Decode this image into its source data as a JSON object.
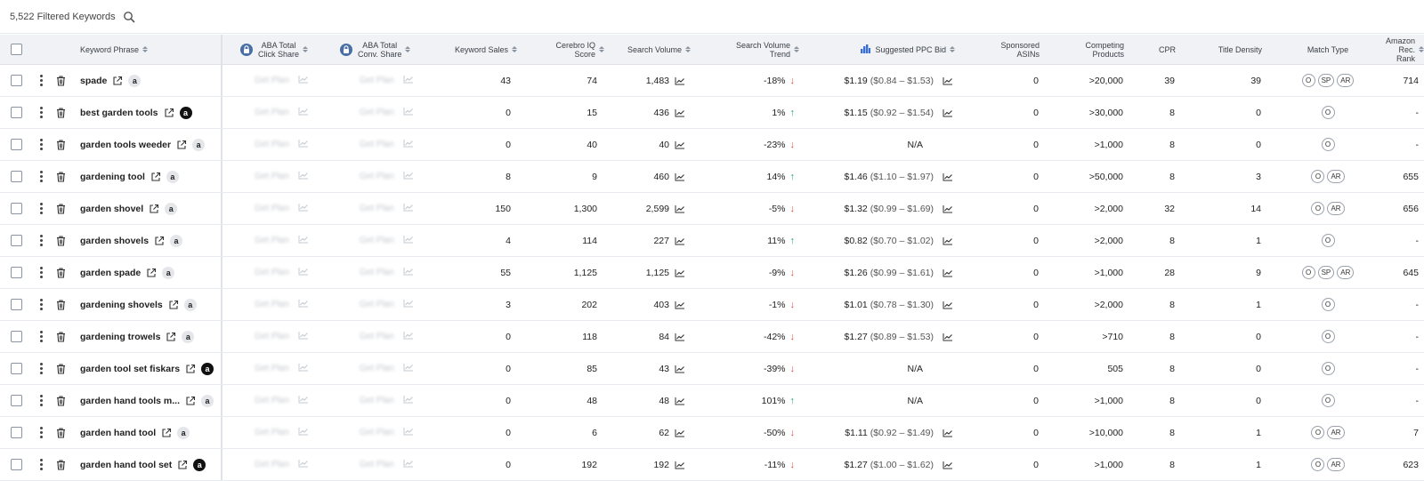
{
  "toolbar": {
    "filtered_count": "5,522 Filtered Keywords"
  },
  "columns": {
    "keyword_phrase": "Keyword Phrase",
    "aba_click_1": "ABA Total",
    "aba_click_2": "Click Share",
    "aba_conv_1": "ABA Total",
    "aba_conv_2": "Conv. Share",
    "keyword_sales": "Keyword Sales",
    "cerebro_1": "Cerebro IQ",
    "cerebro_2": "Score",
    "search_volume": "Search Volume",
    "sv_trend_1": "Search Volume",
    "sv_trend_2": "Trend",
    "ppc": "Suggested PPC Bid",
    "sponsored_1": "Sponsored",
    "sponsored_2": "ASINs",
    "competing_1": "Competing",
    "competing_2": "Products",
    "cpr": "CPR",
    "title_density": "Title Density",
    "match_type": "Match Type",
    "amazon_rank_1": "Amazon Rec.",
    "amazon_rank_2": "Rank"
  },
  "blurred_text": "Get Plan",
  "rows": [
    {
      "keyword": "spade",
      "amz": "light",
      "sales": "43",
      "iq": "74",
      "volume": "1,483",
      "trend": "-18%",
      "dir": "down",
      "ppc": "$1.19",
      "ppc_range": "($0.84 – $1.53)",
      "sponsored": "0",
      "competing": ">20,000",
      "cpr": "39",
      "title_density": "39",
      "match": [
        "O",
        "SP",
        "AR"
      ],
      "rank": "714"
    },
    {
      "keyword": "best garden tools",
      "amz": "dark",
      "sales": "0",
      "iq": "15",
      "volume": "436",
      "trend": "1%",
      "dir": "up",
      "ppc": "$1.15",
      "ppc_range": "($0.92 – $1.54)",
      "sponsored": "0",
      "competing": ">30,000",
      "cpr": "8",
      "title_density": "0",
      "match": [
        "O"
      ],
      "rank": "-"
    },
    {
      "keyword": "garden tools weeder",
      "amz": "light",
      "sales": "0",
      "iq": "40",
      "volume": "40",
      "trend": "-23%",
      "dir": "down",
      "ppc": "N/A",
      "ppc_range": "",
      "sponsored": "0",
      "competing": ">1,000",
      "cpr": "8",
      "title_density": "0",
      "match": [
        "O"
      ],
      "rank": "-"
    },
    {
      "keyword": "gardening tool",
      "amz": "light",
      "sales": "8",
      "iq": "9",
      "volume": "460",
      "trend": "14%",
      "dir": "up",
      "ppc": "$1.46",
      "ppc_range": "($1.10 – $1.97)",
      "sponsored": "0",
      "competing": ">50,000",
      "cpr": "8",
      "title_density": "3",
      "match": [
        "O",
        "AR"
      ],
      "rank": "655"
    },
    {
      "keyword": "garden shovel",
      "amz": "light",
      "sales": "150",
      "iq": "1,300",
      "volume": "2,599",
      "trend": "-5%",
      "dir": "down",
      "ppc": "$1.32",
      "ppc_range": "($0.99 – $1.69)",
      "sponsored": "0",
      "competing": ">2,000",
      "cpr": "32",
      "title_density": "14",
      "match": [
        "O",
        "AR"
      ],
      "rank": "656"
    },
    {
      "keyword": "garden shovels",
      "amz": "light",
      "sales": "4",
      "iq": "114",
      "volume": "227",
      "trend": "11%",
      "dir": "up",
      "ppc": "$0.82",
      "ppc_range": "($0.70 – $1.02)",
      "sponsored": "0",
      "competing": ">2,000",
      "cpr": "8",
      "title_density": "1",
      "match": [
        "O"
      ],
      "rank": "-"
    },
    {
      "keyword": "garden spade",
      "amz": "light",
      "sales": "55",
      "iq": "1,125",
      "volume": "1,125",
      "trend": "-9%",
      "dir": "down",
      "ppc": "$1.26",
      "ppc_range": "($0.99 – $1.61)",
      "sponsored": "0",
      "competing": ">1,000",
      "cpr": "28",
      "title_density": "9",
      "match": [
        "O",
        "SP",
        "AR"
      ],
      "rank": "645"
    },
    {
      "keyword": "gardening shovels",
      "amz": "light",
      "sales": "3",
      "iq": "202",
      "volume": "403",
      "trend": "-1%",
      "dir": "down",
      "ppc": "$1.01",
      "ppc_range": "($0.78 – $1.30)",
      "sponsored": "0",
      "competing": ">2,000",
      "cpr": "8",
      "title_density": "1",
      "match": [
        "O"
      ],
      "rank": "-"
    },
    {
      "keyword": "gardening trowels",
      "amz": "light",
      "sales": "0",
      "iq": "118",
      "volume": "84",
      "trend": "-42%",
      "dir": "down",
      "ppc": "$1.27",
      "ppc_range": "($0.89 – $1.53)",
      "sponsored": "0",
      "competing": ">710",
      "cpr": "8",
      "title_density": "0",
      "match": [
        "O"
      ],
      "rank": "-"
    },
    {
      "keyword": "garden tool set fiskars",
      "amz": "dark",
      "sales": "0",
      "iq": "85",
      "volume": "43",
      "trend": "-39%",
      "dir": "down",
      "ppc": "N/A",
      "ppc_range": "",
      "sponsored": "0",
      "competing": "505",
      "cpr": "8",
      "title_density": "0",
      "match": [
        "O"
      ],
      "rank": "-"
    },
    {
      "keyword": "garden hand tools m...",
      "amz": "light",
      "sales": "0",
      "iq": "48",
      "volume": "48",
      "trend": "101%",
      "dir": "up",
      "ppc": "N/A",
      "ppc_range": "",
      "sponsored": "0",
      "competing": ">1,000",
      "cpr": "8",
      "title_density": "0",
      "match": [
        "O"
      ],
      "rank": "-"
    },
    {
      "keyword": "garden hand tool",
      "amz": "light",
      "sales": "0",
      "iq": "6",
      "volume": "62",
      "trend": "-50%",
      "dir": "down",
      "ppc": "$1.11",
      "ppc_range": "($0.92 – $1.49)",
      "sponsored": "0",
      "competing": ">10,000",
      "cpr": "8",
      "title_density": "1",
      "match": [
        "O",
        "AR"
      ],
      "rank": "7"
    },
    {
      "keyword": "garden hand tool set",
      "amz": "dark",
      "sales": "0",
      "iq": "192",
      "volume": "192",
      "trend": "-11%",
      "dir": "down",
      "ppc": "$1.27",
      "ppc_range": "($1.00 – $1.62)",
      "sponsored": "0",
      "competing": ">1,000",
      "cpr": "8",
      "title_density": "1",
      "match": [
        "O",
        "AR"
      ],
      "rank": "623"
    }
  ],
  "colors": {
    "trend_down": "#e04a4a",
    "trend_up": "#27a56b",
    "lock_badge": "#4a6fa5"
  }
}
